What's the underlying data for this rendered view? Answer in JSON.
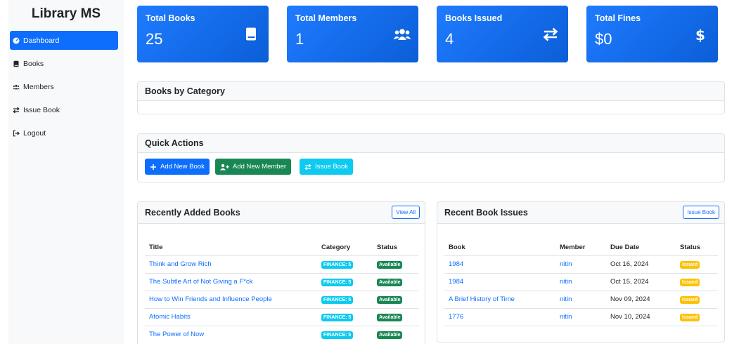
{
  "sidebar": {
    "brand": "Library MS",
    "items": [
      {
        "label": "Dashboard",
        "icon": "dashboard-icon",
        "active": true
      },
      {
        "label": "Books",
        "icon": "book-icon"
      },
      {
        "label": "Members",
        "icon": "users-icon"
      },
      {
        "label": "Issue Book",
        "icon": "exchange-icon"
      },
      {
        "label": "Logout",
        "icon": "logout-icon"
      }
    ]
  },
  "stats": [
    {
      "label": "Total Books",
      "value": "25",
      "icon": "book-icon"
    },
    {
      "label": "Total Members",
      "value": "1",
      "icon": "users-icon"
    },
    {
      "label": "Books Issued",
      "value": "4",
      "icon": "exchange-icon"
    },
    {
      "label": "Total Fines",
      "value": "$0",
      "icon": "dollar-icon"
    }
  ],
  "category_card": {
    "title": "Books by Category"
  },
  "quick_actions": {
    "title": "Quick Actions",
    "buttons": [
      {
        "label": "Add New Book",
        "color": "#0d6efd"
      },
      {
        "label": "Add New Member",
        "color": "#198754"
      },
      {
        "label": "Issue Book",
        "color": "#0dcaf0"
      }
    ]
  },
  "recent_books": {
    "title": "Recently Added Books",
    "action": "View All",
    "headers": [
      "Title",
      "Category",
      "Status"
    ],
    "rows": [
      {
        "title": "Think and Grow Rich",
        "category": "FINANCE: 5",
        "status": "Available"
      },
      {
        "title": "The Subtle Art of Not Giving a F*ck",
        "category": "FINANCE: 5",
        "status": "Available"
      },
      {
        "title": "How to Win Friends and Influence People",
        "category": "FINANCE: 5",
        "status": "Available"
      },
      {
        "title": "Atomic Habits",
        "category": "FINANCE: 5",
        "status": "Available"
      },
      {
        "title": "The Power of Now",
        "category": "FINANCE: 5",
        "status": "Available"
      }
    ]
  },
  "recent_issues": {
    "title": "Recent Book Issues",
    "action": "Issue Book",
    "headers": [
      "Book",
      "Member",
      "Due Date",
      "Status"
    ],
    "rows": [
      {
        "book": "1984",
        "member": "nitin",
        "due": "Oct 16, 2024",
        "status": "Issued"
      },
      {
        "book": "1984",
        "member": "nitin",
        "due": "Oct 15, 2024",
        "status": "Issued"
      },
      {
        "book": "A Brief History of Time",
        "member": "nitin",
        "due": "Nov 09, 2024",
        "status": "Issued"
      },
      {
        "book": "1776",
        "member": "nitin",
        "due": "Nov 10, 2024",
        "status": "Issued"
      }
    ]
  },
  "colors": {
    "primary": "#0d6efd",
    "success": "#198754",
    "info": "#0dcaf0",
    "warning": "#ffc107"
  }
}
